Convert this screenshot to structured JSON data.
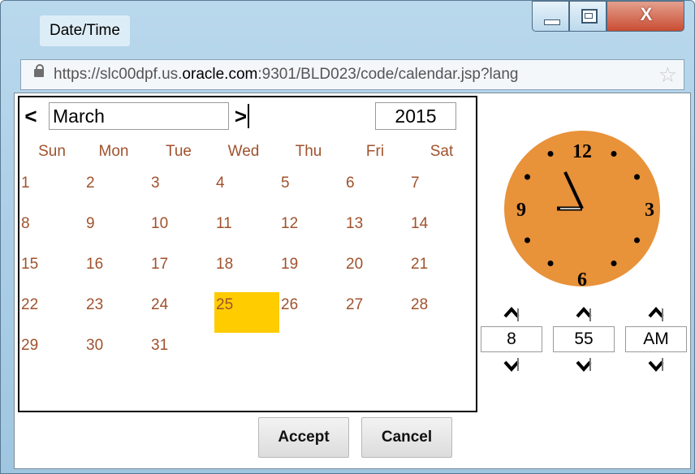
{
  "window": {
    "title": "Date/Time",
    "close_glyph": "X",
    "url_prefix": "https://slc00dpf.us.",
    "url_domain": "oracle.com",
    "url_suffix": ":9301/BLD023/code/calendar.jsp?lang"
  },
  "calendar": {
    "prev_glyph": "<",
    "next_glyph": ">",
    "month": "March",
    "year": "2015",
    "weekdays": [
      "Sun",
      "Mon",
      "Tue",
      "Wed",
      "Thu",
      "Fri",
      "Sat"
    ],
    "days": [
      "1",
      "2",
      "3",
      "4",
      "5",
      "6",
      "7",
      "8",
      "9",
      "10",
      "11",
      "12",
      "13",
      "14",
      "15",
      "16",
      "17",
      "18",
      "19",
      "20",
      "21",
      "22",
      "23",
      "24",
      "25",
      "26",
      "27",
      "28",
      "29",
      "30",
      "31"
    ],
    "first_weekday_index": 0,
    "selected_day": "25"
  },
  "clock": {
    "numerals": {
      "twelve": "12",
      "three": "3",
      "six": "6",
      "nine": "9"
    },
    "face_color": "#e8923a",
    "hour": "8",
    "minute": "55",
    "ampm": "AM"
  },
  "actions": {
    "accept_label": "Accept",
    "cancel_label": "Cancel"
  }
}
